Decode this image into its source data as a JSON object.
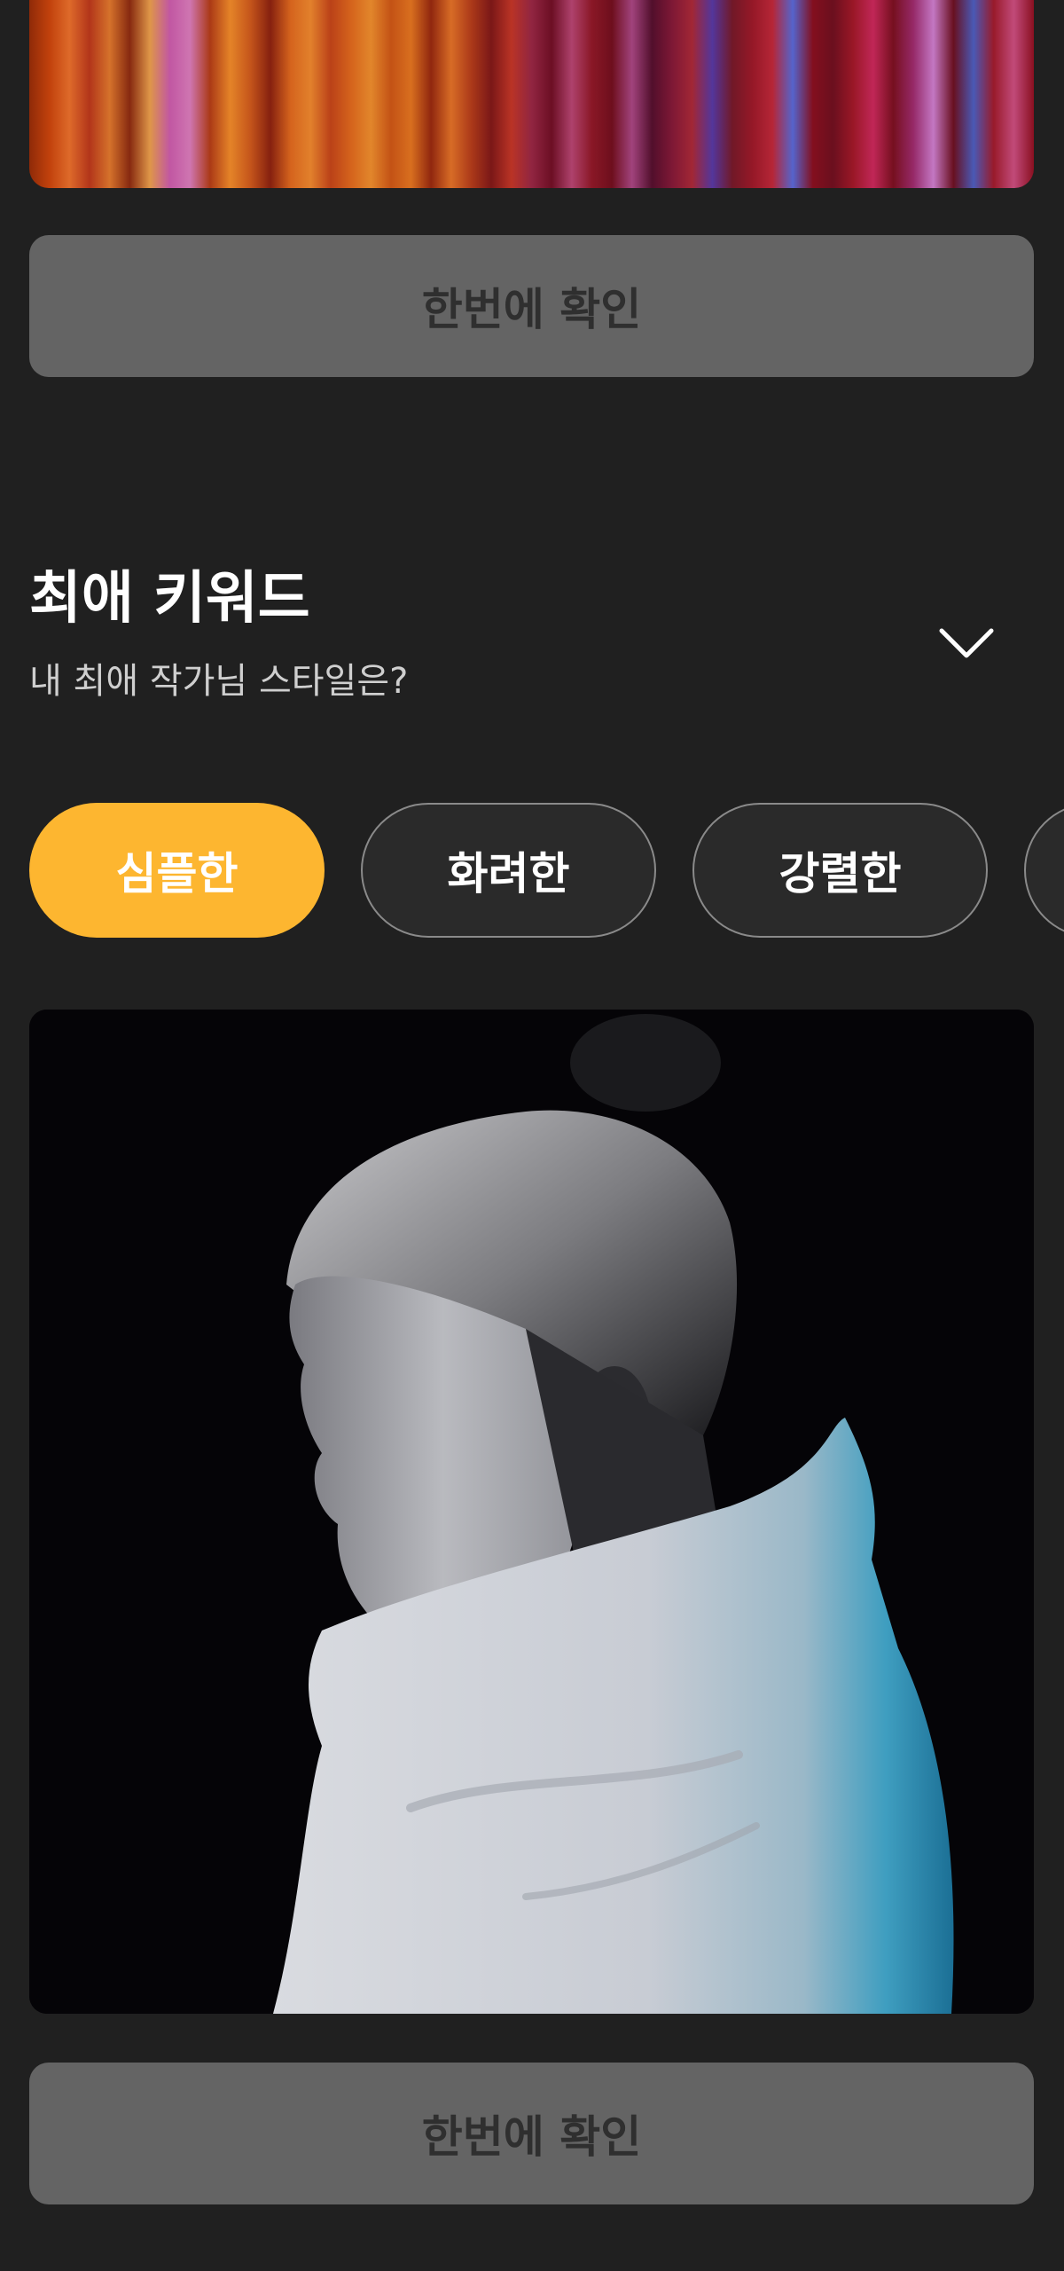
{
  "banner": {
    "icon": "striped-artwork-image"
  },
  "top_confirm_button": {
    "label": "한번에 확인"
  },
  "section": {
    "title": "최애 키워드",
    "subtitle": "내 최애 작가님 스타일은?",
    "toggle_icon": "chevron-down-icon"
  },
  "keyword_chips": [
    {
      "label": "심플한",
      "selected": true
    },
    {
      "label": "화려한",
      "selected": false
    },
    {
      "label": "강렬한",
      "selected": false
    },
    {
      "label": "",
      "selected": false
    }
  ],
  "colors": {
    "background": "#202020",
    "accent": "#fdb630",
    "button_bg": "#646464",
    "button_text": "#2f2f2f"
  },
  "photo": {
    "icon": "portrait-photo"
  },
  "bottom_confirm_button": {
    "label": "한번에 확인"
  }
}
